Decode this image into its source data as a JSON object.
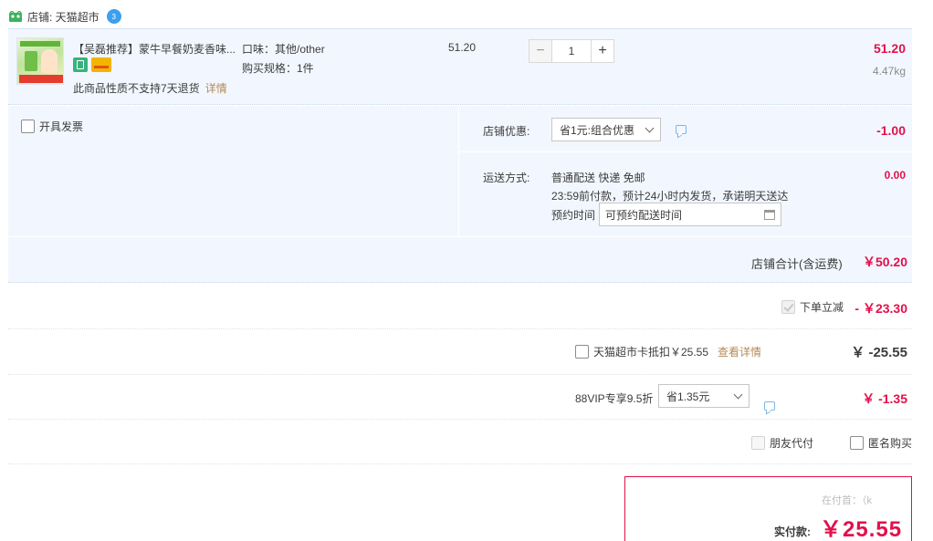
{
  "shop": {
    "label": "店铺: 天猫超市",
    "badge": "3"
  },
  "item": {
    "title": "【吴磊推荐】蒙牛早餐奶麦香味...",
    "no_return": "此商品性质不支持7天退货",
    "detail_link": "详情",
    "spec_flavor": "口味：其他/other",
    "spec_size": "购买规格：1件",
    "unit_price": "51.20",
    "quantity": "1",
    "qty_minus": "−",
    "qty_plus": "+",
    "subtotal": "51.20",
    "weight": "4.47kg"
  },
  "invoice": {
    "label": "开具发票"
  },
  "shop_discount": {
    "label": "店铺优惠:",
    "selected": "省1元:组合优惠",
    "amount": "-1.00"
  },
  "shipping": {
    "label": "运送方式:",
    "line1": "普通配送 快递 免邮",
    "line2": "23:59前付款，预计24小时内发货，承诺明天送达",
    "schedule_label": "预约时间",
    "schedule_placeholder": "可预约配送时间",
    "amount": "0.00"
  },
  "shop_total": {
    "label": "店铺合计(含运费)",
    "amount": "￥50.20"
  },
  "instant_discount": {
    "label": "下单立减",
    "amount": "- ￥23.30"
  },
  "card": {
    "label": "天猫超市卡抵扣￥25.55",
    "link": "查看详情",
    "amount": "￥ -25.55"
  },
  "vip": {
    "label": "88VIP专享9.5折",
    "selected": "省1.35元",
    "amount": "￥ -1.35"
  },
  "options": {
    "friend_pay": "朋友代付",
    "anonymous": "匿名购买"
  },
  "payment": {
    "faded_text": "在付首：（k",
    "label": "实付款:",
    "amount": "￥25.55"
  },
  "colors": {
    "accent": "#e3104b",
    "panel_bg": "#f2f7ff",
    "link": "#b48a55"
  }
}
